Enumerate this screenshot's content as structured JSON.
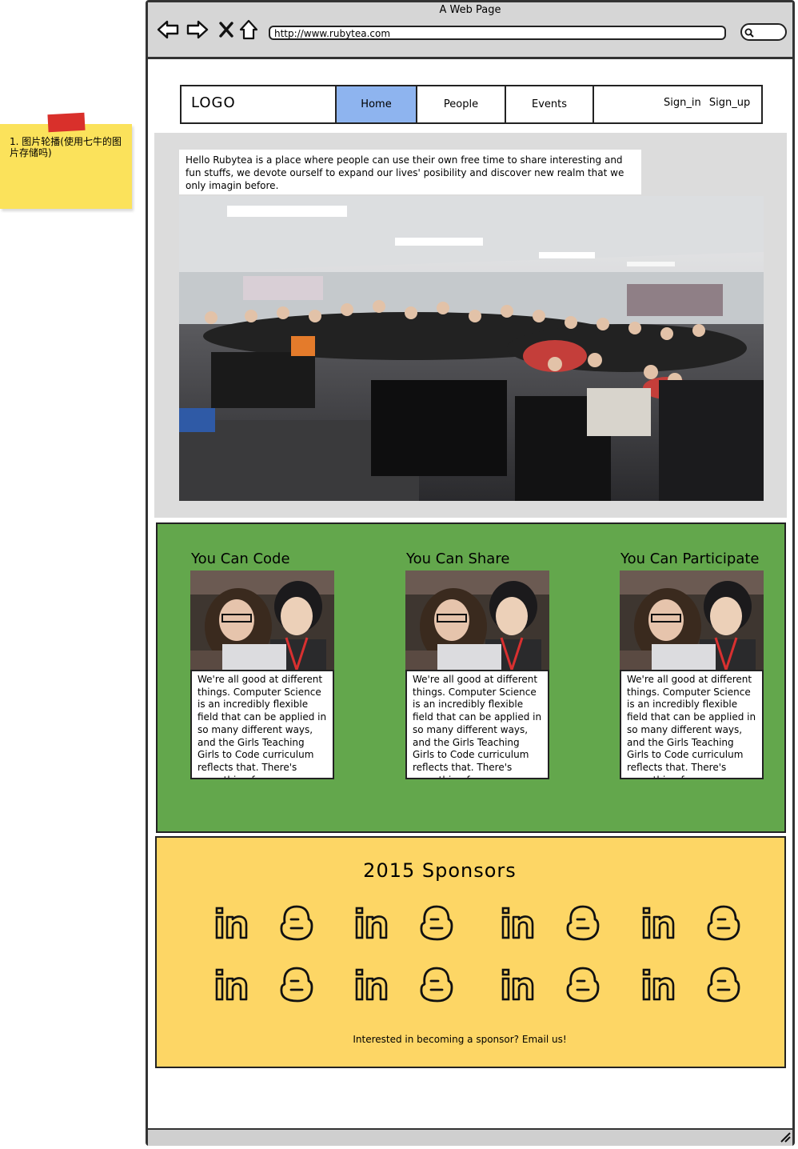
{
  "note": {
    "text": "1. 图片轮播(使用七牛的图片存储吗)"
  },
  "browser": {
    "window_title": "A Web Page",
    "address": "http://www.rubytea.com"
  },
  "nav": {
    "logo": "LOGO",
    "tabs": [
      {
        "label": "Home",
        "active": true
      },
      {
        "label": "People",
        "active": false
      },
      {
        "label": "Events",
        "active": false
      }
    ],
    "sign_in": "Sign_in",
    "sign_up": "Sign_up"
  },
  "hero": {
    "intro": "Hello Rubytea is a place where people can use their own free time to share interesting and fun stuffs, we devote ourself to expand our lives' posibility and discover new realm that we only imagin before."
  },
  "features": [
    {
      "title": "You Can Code",
      "text": "We're all good at different things. Computer Science is an incredibly flexible field that can be applied in so many different ways, and the Girls Teaching Girls to Code curriculum reflects that. There's something for everyone."
    },
    {
      "title": "You Can Share",
      "text": "We're all good at different things. Computer Science is an incredibly flexible field that can be applied in so many different ways, and the Girls Teaching Girls to Code curriculum reflects that. There's something for everyone."
    },
    {
      "title": "You Can Participate",
      "text": "We're all good at different things. Computer Science is an incredibly flexible field that can be applied in so many different ways, and the Girls Teaching Girls to Code curriculum reflects that. There's something for everyone."
    }
  ],
  "sponsors": {
    "title": "2015 Sponsors",
    "icons": [
      "linkedin-icon",
      "blogger-icon"
    ],
    "cta": "Interested in becoming a sponsor? Email us!"
  },
  "colors": {
    "active_tab": "#8eb4ef",
    "hero_bg": "#dcdcdc",
    "features_bg": "#63a74c",
    "sponsors_bg": "#fdd665",
    "sticky_note": "#fbe25b",
    "tape": "#d9302b"
  }
}
